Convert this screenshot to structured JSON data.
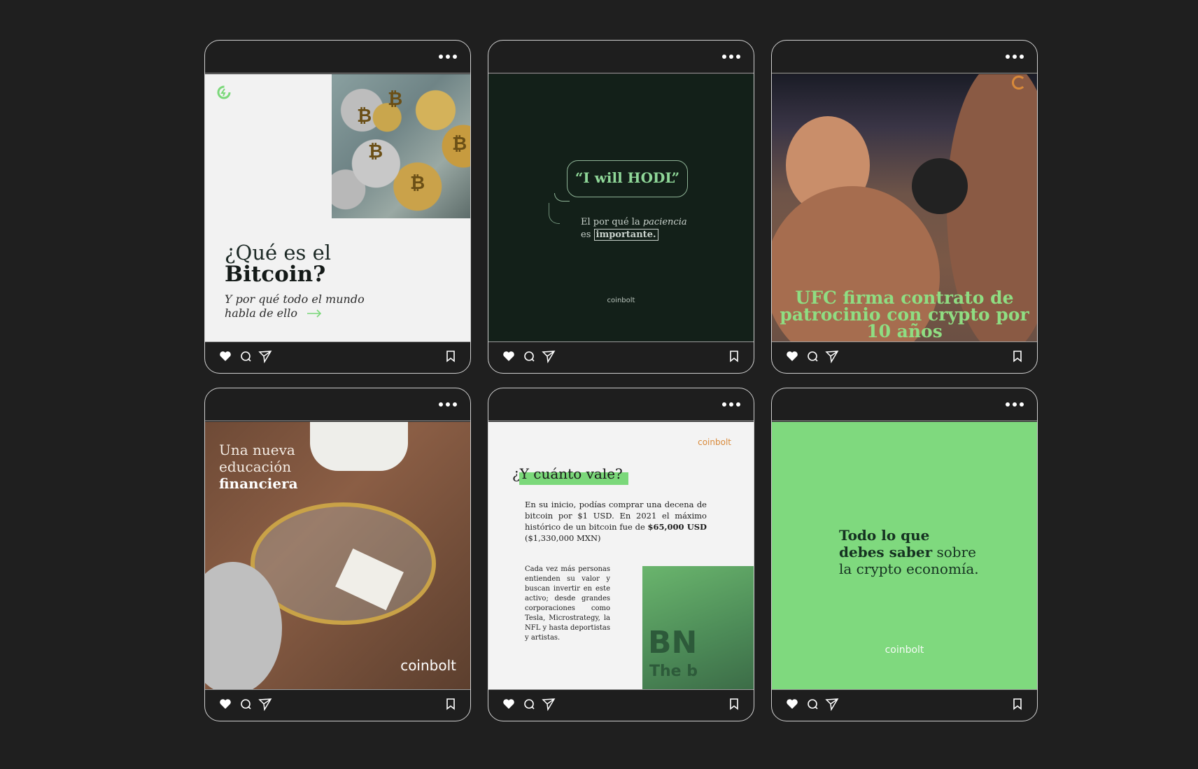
{
  "brand": "coinbolt",
  "colors": {
    "background": "#1f1f1f",
    "accent_green": "#7fd97e",
    "dark_green": "#132019",
    "orange": "#d98a3a"
  },
  "posts": [
    {
      "title_light": "¿Qué es el",
      "title_bold": "Bitcoin?",
      "subtitle_line1": "Y por qué todo el mundo",
      "subtitle_line2": "habla de ello"
    },
    {
      "quote": "“I will HODL”",
      "line1_prefix": "El por qué la ",
      "line1_em": "paciencia",
      "line2_prefix": "es ",
      "line2_bold": "importante.",
      "brand": "coinbolt"
    },
    {
      "headline": "UFC firma contrato de patrocinio con crypto por 10 años"
    },
    {
      "line1": "Una nueva",
      "line2": "educación",
      "line3": "financiera",
      "brand": "coinbolt"
    },
    {
      "brand": "coinbolt",
      "heading": "¿Y cuánto vale?",
      "para1_text": "En su inicio, podías comprar una decena de bitcoin por $1 USD. En 2021 el máximo histórico de un bitcoin fue de ",
      "para1_bold": "$65,000 USD",
      "para1_end": " ($1,330,000 MXN)",
      "para2": "Cada vez más personas entienden su valor y buscan invertir en este activo; desde grandes corporaciones como Tesla, Microstrategy, la NFL y hasta deportistas y artistas.",
      "photo_text1": "BN",
      "photo_text2": "The b"
    },
    {
      "bold": "Todo lo que debes saber",
      "rest": " sobre la crypto economía.",
      "brand": "coinbolt"
    }
  ]
}
